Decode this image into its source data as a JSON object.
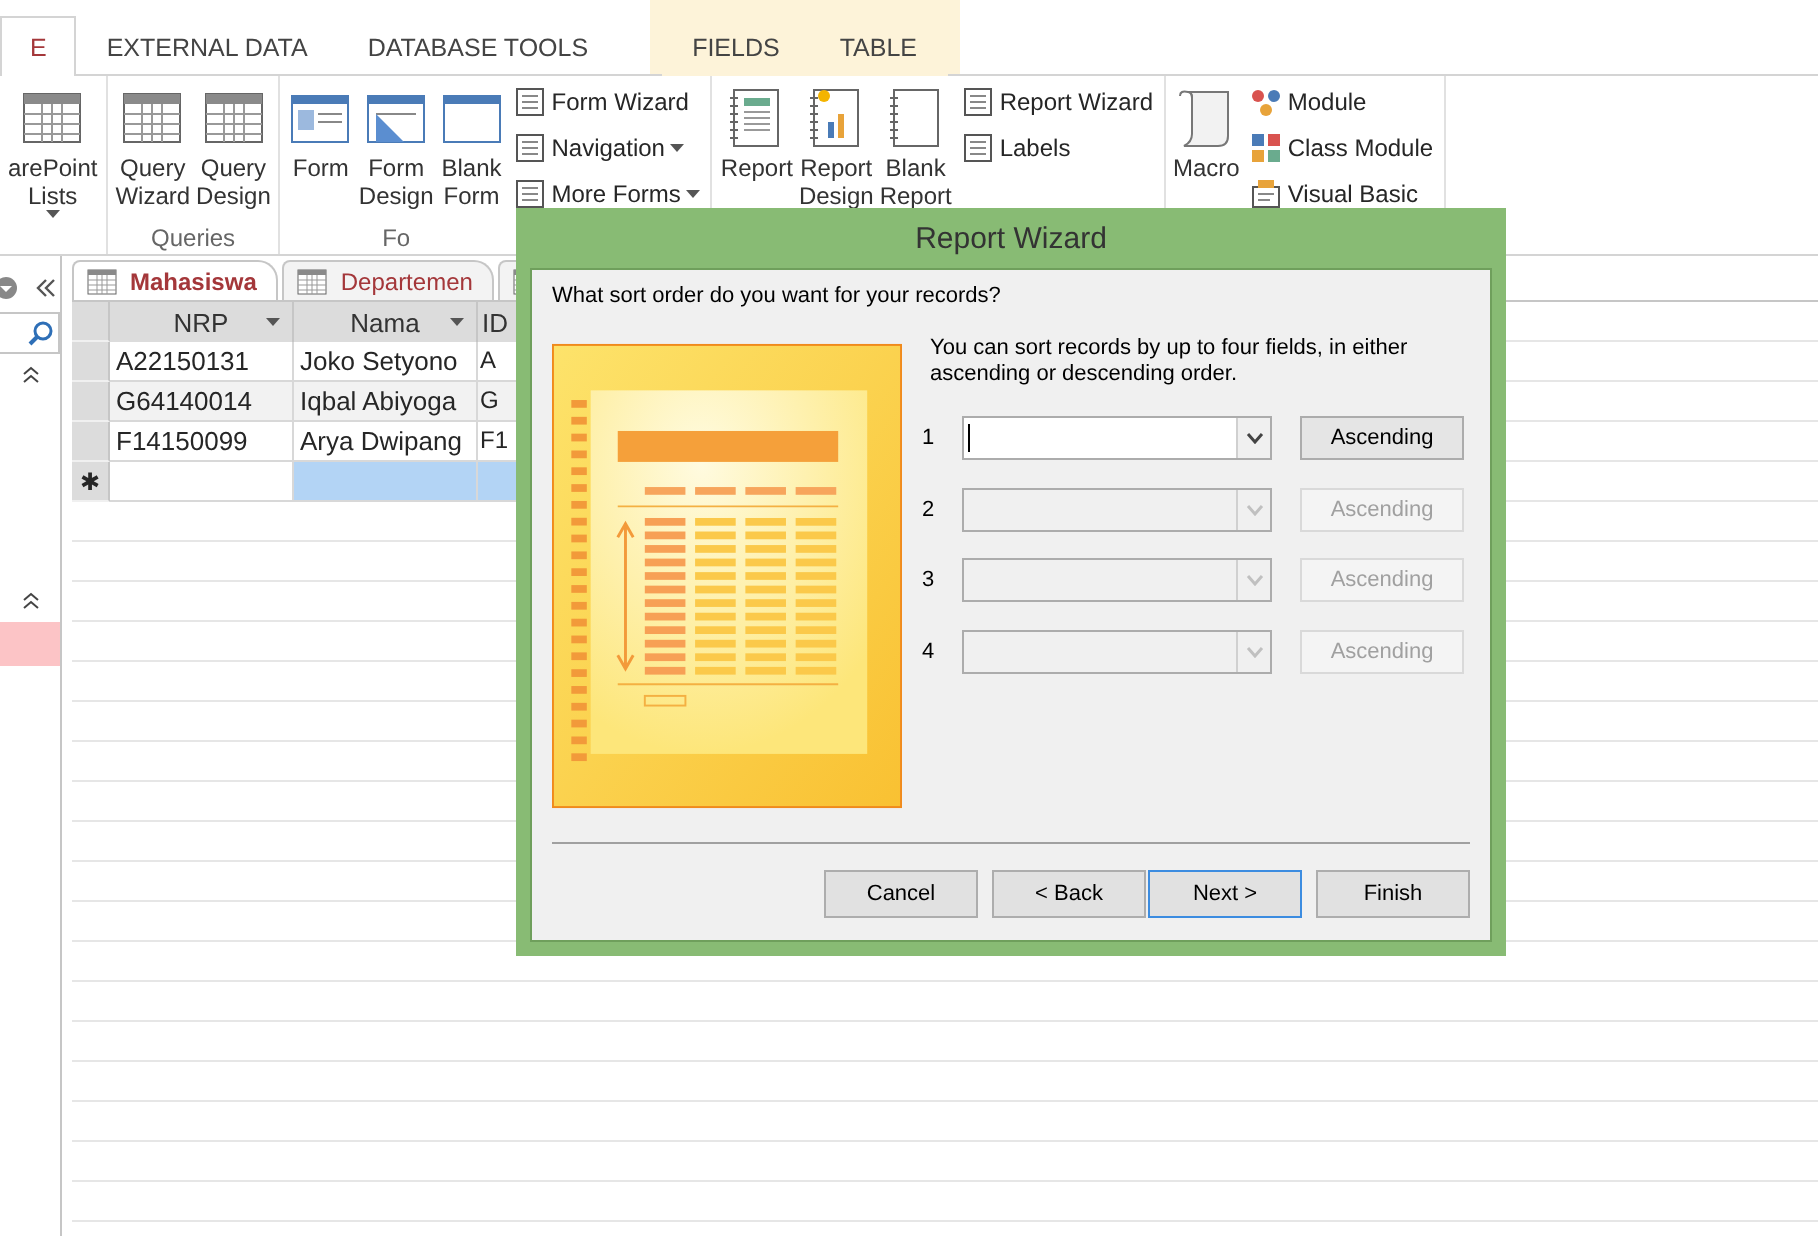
{
  "ribbon_tabs": [
    {
      "label": "E",
      "selected": true,
      "kind": "main"
    },
    {
      "label": "EXTERNAL DATA",
      "selected": false,
      "kind": "main"
    },
    {
      "label": "DATABASE TOOLS",
      "selected": false,
      "kind": "main"
    },
    {
      "label": "FIELDS",
      "selected": false,
      "kind": "contextual"
    },
    {
      "label": "TABLE",
      "selected": false,
      "kind": "contextual"
    }
  ],
  "ribbon_groups": [
    {
      "large": [
        {
          "label": "arePoint Lists",
          "dropdown": true
        }
      ]
    },
    {
      "label": "Queries",
      "large": [
        {
          "label": "Query Wizard"
        },
        {
          "label": "Query Design"
        }
      ]
    },
    {
      "label": "Fo",
      "large": [
        {
          "label": "Form"
        },
        {
          "label": "Form Design"
        },
        {
          "label": "Blank Form"
        }
      ],
      "small": [
        {
          "label": "Form Wizard"
        },
        {
          "label": "Navigation",
          "dropdown": true
        },
        {
          "label": "More Forms",
          "dropdown": true
        }
      ]
    },
    {
      "large": [
        {
          "label": "Report"
        },
        {
          "label": "Report Design"
        },
        {
          "label": "Blank Report"
        }
      ],
      "small": [
        {
          "label": "Report Wizard"
        },
        {
          "label": "Labels"
        }
      ]
    },
    {
      "large": [
        {
          "label": "Macro"
        }
      ],
      "small": [
        {
          "label": "Module"
        },
        {
          "label": "Class Module"
        },
        {
          "label": "Visual Basic"
        }
      ]
    }
  ],
  "nav_pane": {
    "items": [
      {
        "selected": true
      }
    ]
  },
  "doc_tabs": [
    {
      "label": "Mahasiswa",
      "selected": true
    },
    {
      "label": "Departemen",
      "selected": false
    },
    {
      "selected": false
    }
  ],
  "table": {
    "columns": [
      "NRP",
      "Nama",
      "ID"
    ],
    "rows": [
      [
        "A22150131",
        "Joko Setyono",
        "A"
      ],
      [
        "G64140014",
        "Iqbal Abiyoga",
        "G"
      ],
      [
        "F14150099",
        "Arya Dwipang",
        "F1"
      ]
    ],
    "new_row": {
      "marker": "✱",
      "cells": [
        {
          "selected": false
        },
        {
          "selected": true
        },
        {
          "selected": true
        }
      ]
    }
  },
  "dialog": {
    "title": "Report Wizard",
    "question": "What sort order do you want for your records?",
    "description": "You can sort records by up to four fields, in either ascending or descending order.",
    "sort_rows": [
      {
        "number": "1",
        "order": "Ascending",
        "disabled": false,
        "focused": true
      },
      {
        "number": "2",
        "order": "Ascending",
        "disabled": true,
        "focused": false
      },
      {
        "number": "3",
        "order": "Ascending",
        "disabled": true,
        "focused": false
      },
      {
        "number": "4",
        "order": "Ascending",
        "disabled": true,
        "focused": false
      }
    ],
    "buttons": [
      {
        "label": "Cancel",
        "focused": false
      },
      {
        "label": "< Back",
        "focused": false
      },
      {
        "label": "Next >",
        "focused": true
      },
      {
        "label": "Finish",
        "focused": false
      }
    ]
  }
}
